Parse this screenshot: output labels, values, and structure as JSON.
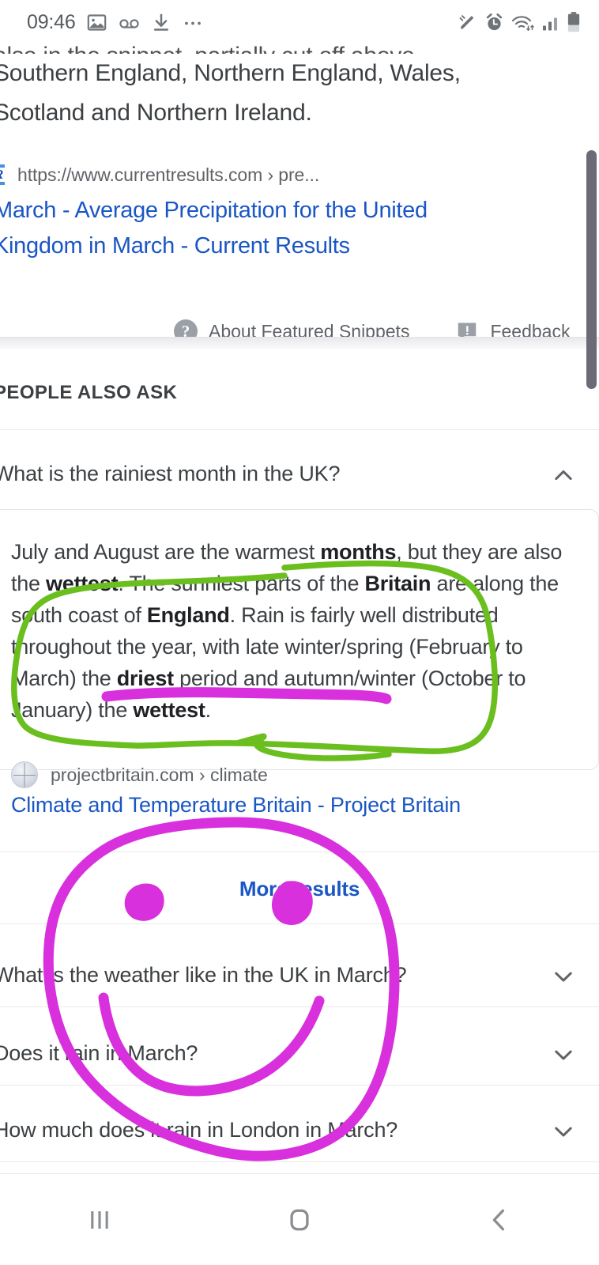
{
  "status_bar": {
    "time": "09:46",
    "left_icons": [
      "image-icon",
      "voicemail-icon",
      "download-icon",
      "more-icon"
    ],
    "right_icons": [
      "pen-icon",
      "alarm-icon",
      "wifi-icon",
      "signal-icon",
      "battery-icon"
    ]
  },
  "search_result": {
    "snippet_tail_clipped": "also in the snippet, partially cut off above",
    "snippet_tail_line1": "Southern England, Northern England, Wales,",
    "snippet_tail_line2": "Scotland and Northern Ireland.",
    "source_favicon": "currentresults-favicon",
    "source_favicon_text": "CR",
    "source_url": "https://www.currentresults.com › pre...",
    "title_line1": "March - Average Precipitation for the United",
    "title_line2": "Kingdom in March - Current Results",
    "about_snippets_label": "About Featured Snippets",
    "feedback_label": "Feedback"
  },
  "people_also_ask": {
    "header": "PEOPLE ALSO ASK",
    "questions": [
      {
        "text": "What is the rainiest month in the UK?",
        "expanded": true,
        "chevron": "chevron-up-icon"
      },
      {
        "text": "What is the weather like in the UK in March?",
        "expanded": false,
        "chevron": "chevron-down-icon"
      },
      {
        "text": "Does it rain in March?",
        "expanded": false,
        "chevron": "chevron-down-icon"
      },
      {
        "text": "How much does it rain in London in March?",
        "expanded": false,
        "chevron": "chevron-down-icon"
      }
    ],
    "answer": {
      "p1": "July and August are the warmest ",
      "b1": "months",
      "p2": ", but they are also the ",
      "b2": "wettest",
      "p3": ". The sunniest parts of the ",
      "b3": "Britain",
      "p4": " are along the south coast of ",
      "b4": "England",
      "p5": ". Rain is fairly well distributed throughout the year, with late winter/spring (February to March) the ",
      "b5": "driest",
      "p6": " period and autumn/winter (October to January) the ",
      "b6": "wettest",
      "p7": ".",
      "source_favicon": "globe-icon",
      "source_url": "projectbritain.com › climate",
      "link_title": "Climate and Temperature Britain - Project Britain"
    },
    "more_results_label": "More results"
  },
  "nav_bar": {
    "recents": "recents-icon",
    "home": "home-icon",
    "back": "back-icon"
  },
  "annotations": {
    "green_color": "#6abf1f",
    "magenta_color": "#d830dd",
    "green_shape": "freehand-oval-around-snippet-text",
    "magenta_underline": "freehand-underline-under-driest-phrase",
    "magenta_smiley": "freehand-smiley-face-over-questions"
  },
  "colors": {
    "link_blue": "#1a56c4",
    "text_dark": "#3c4043",
    "text_gray": "#5f6368",
    "divider": "#ebebeb",
    "scrollbar": "#6b6b77"
  }
}
